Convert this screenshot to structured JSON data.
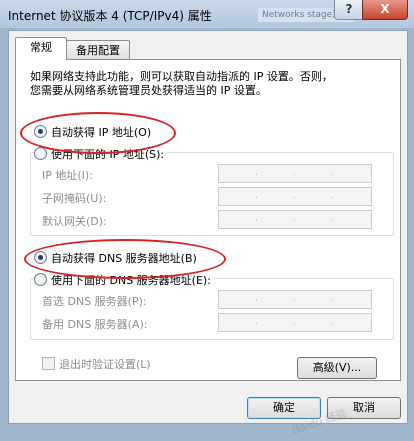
{
  "window": {
    "title": "Internet 协议版本 4 (TCP/IPv4) 属性",
    "background_window_text": "Networks stage)",
    "help_label": "?",
    "close_label": "X"
  },
  "tabs": [
    {
      "label": "常规",
      "active": true
    },
    {
      "label": "备用配置",
      "active": false
    }
  ],
  "description": [
    "如果网络支持此功能，则可以获取自动指派的 IP 设置。否则，",
    "您需要从网络系统管理员处获得适当的 IP 设置。"
  ],
  "ip_section": {
    "auto_label": "自动获得 IP 地址(O)",
    "auto_selected": true,
    "manual_label": "使用下面的 IP 地址(S):",
    "fields": [
      {
        "label": "IP 地址(I):"
      },
      {
        "label": "子网掩码(U):"
      },
      {
        "label": "默认网关(D):"
      }
    ]
  },
  "dns_section": {
    "auto_label": "自动获得 DNS 服务器地址(B)",
    "auto_selected": true,
    "manual_label": "使用下面的 DNS 服务器地址(E):",
    "fields": [
      {
        "label": "首选 DNS 服务器(P):"
      },
      {
        "label": "备用 DNS 服务器(A):"
      }
    ]
  },
  "ip_dot": ".",
  "validate_label": "退出时验证设置(L)",
  "advanced_button": "高级(V)...",
  "ok_button": "确定",
  "cancel_button": "取消",
  "annotation_color": "#d52424",
  "watermark": "Baidu 经验"
}
